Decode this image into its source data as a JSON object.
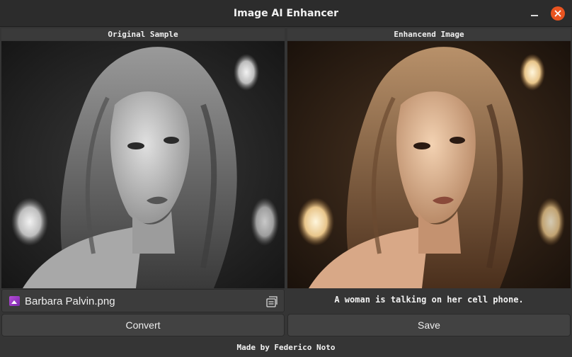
{
  "window": {
    "title": "Image AI Enhancer"
  },
  "left_panel": {
    "header": "Original Sample",
    "file_name": "Barbara Palvin.png",
    "convert_label": "Convert"
  },
  "right_panel": {
    "header": "Enhancend Image",
    "caption": "A woman is talking on her cell phone.",
    "save_label": "Save"
  },
  "footer": {
    "text": "Made by Federico Noto"
  },
  "icons": {
    "minimize": "minimize-icon",
    "close": "close-icon",
    "file": "image-file-icon",
    "browse": "folder-browse-icon"
  },
  "colors": {
    "accent_close": "#e95420",
    "window_bg": "#353535",
    "titlebar_bg": "#2c2c2c"
  }
}
